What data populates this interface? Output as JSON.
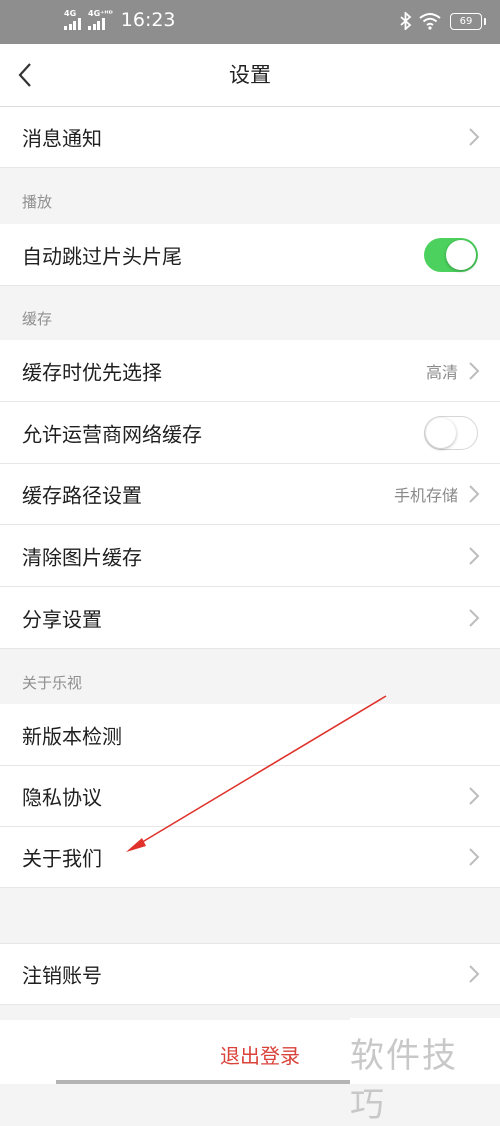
{
  "status_bar": {
    "network_1": "4G",
    "network_2": "4G⁺ᴴᴰ",
    "time": "16:23",
    "battery": "69",
    "icons": [
      "signal-icon",
      "bluetooth-icon",
      "wifi-icon",
      "battery-icon"
    ]
  },
  "header": {
    "title": "设置",
    "back_icon": "chevron-left-icon"
  },
  "rows": {
    "notifications": "消息通知",
    "autoskip": "自动跳过片头片尾",
    "cache_priority": "缓存时优先选择",
    "cache_priority_value": "高清",
    "carrier_cache": "允许运营商网络缓存",
    "cache_path": "缓存路径设置",
    "cache_path_value": "手机存储",
    "clear_cache": "清除图片缓存",
    "share": "分享设置",
    "check_version": "新版本检测",
    "privacy": "隐私协议",
    "about_us": "关于我们",
    "cancel_account": "注销账号"
  },
  "toggles": {
    "autoskip_on": true,
    "carrier_cache_on": false
  },
  "sections": {
    "playback": "播放",
    "cache": "缓存",
    "about": "关于乐视"
  },
  "logout": "退出登录",
  "watermark": "软件技巧",
  "colors": {
    "status_bar": "#8e8e8e",
    "toggle_on": "#4cd15e",
    "logout_text": "#d9433a",
    "annotation_arrow": "#e0322b"
  }
}
